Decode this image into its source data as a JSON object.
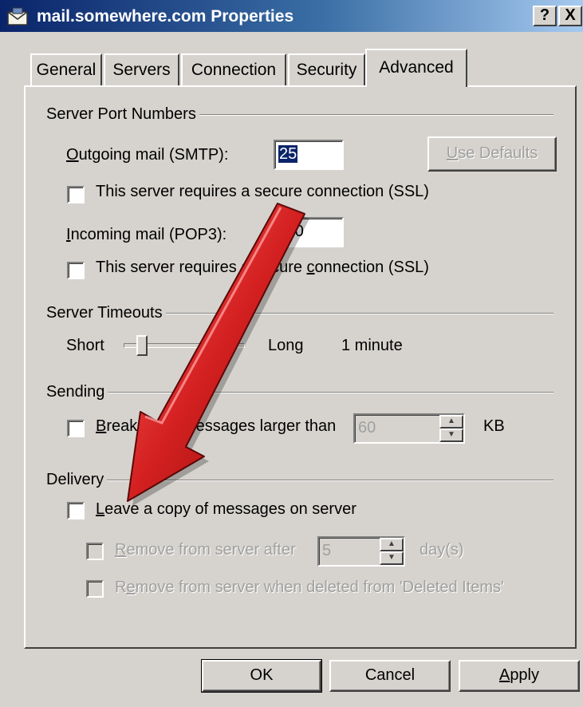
{
  "window": {
    "title": "mail.somewhere.com Properties",
    "help_button": "?",
    "close_button": "X"
  },
  "tabs": [
    {
      "label": "General",
      "active": false
    },
    {
      "label": "Servers",
      "active": false
    },
    {
      "label": "Connection",
      "active": false
    },
    {
      "label": "Security",
      "active": false
    },
    {
      "label": "Advanced",
      "active": true
    }
  ],
  "server_ports": {
    "group_title": "Server Port Numbers",
    "outgoing_label_key": "O",
    "outgoing_label_rest": "utgoing mail (SMTP):",
    "outgoing_value": "25",
    "use_defaults_key": "U",
    "use_defaults_rest": "se Defaults",
    "ssl_outgoing_label": "This server requires a secure connection (SSL)",
    "incoming_label_key": "I",
    "incoming_label_rest": "ncoming mail (POP3):",
    "incoming_value": "110",
    "ssl_incoming_pre": "This server requires a secure ",
    "ssl_incoming_key": "c",
    "ssl_incoming_post": "onnection (SSL)"
  },
  "timeouts": {
    "group_title": "Server Timeouts",
    "short_label": "Short",
    "long_label": "Long",
    "value_text": "1 minute",
    "slider_level": 0.12
  },
  "sending": {
    "group_title": "Sending",
    "break_key": "B",
    "break_rest": "reak apart messages larger than",
    "break_value": "60",
    "unit": "KB"
  },
  "delivery": {
    "group_title": "Delivery",
    "leave_copy_key": "L",
    "leave_copy_rest": "eave a copy of messages on server",
    "remove_after_key": "R",
    "remove_after_rest": "emove from server after",
    "remove_after_value": "5",
    "days_unit": "day(s)",
    "remove_deleted_pre": "R",
    "remove_deleted_key": "e",
    "remove_deleted_post": "move from server when deleted from 'Deleted Items'"
  },
  "buttons": {
    "ok": "OK",
    "cancel": "Cancel",
    "apply_key": "A",
    "apply_rest": "pply"
  },
  "colors": {
    "window_bg": "#d6d3ce",
    "titlebar_start": "#0a246a",
    "arrow_red": "#d42020"
  }
}
